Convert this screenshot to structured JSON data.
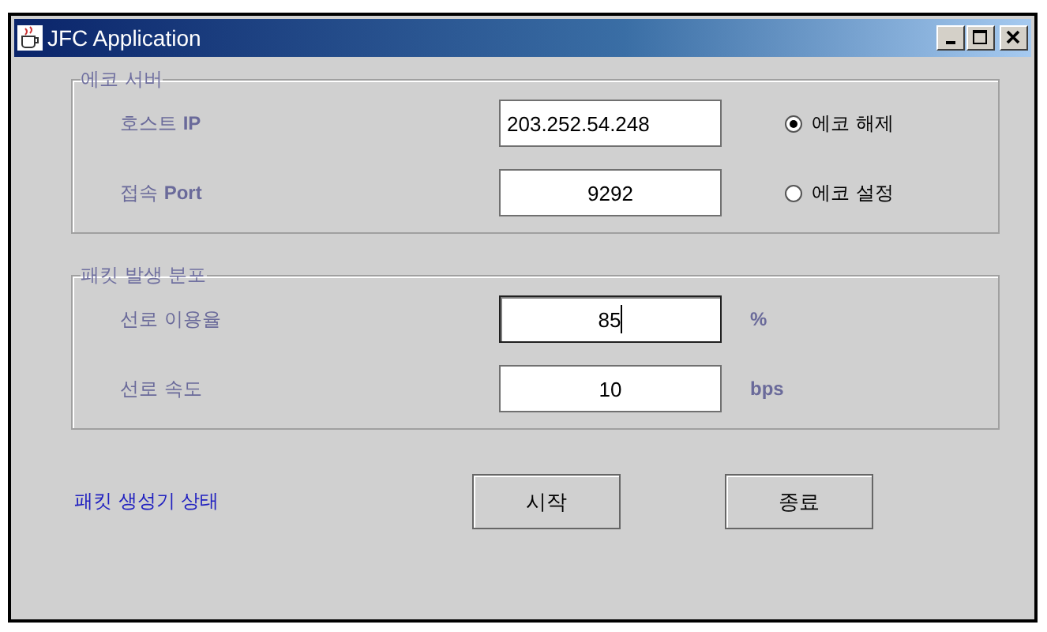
{
  "window": {
    "title": "JFC Application"
  },
  "server_group": {
    "title": "에코 서버",
    "fields": [
      {
        "label": "호스트 **IP**",
        "value": "203.252.54.248",
        "focused": false
      },
      {
        "label": "접속 **Port**",
        "value": "9292",
        "focused": false
      }
    ],
    "radios": [
      {
        "label": "에코 해제",
        "selected": true
      },
      {
        "label": "에코 설정",
        "selected": false
      }
    ]
  },
  "packet_group": {
    "title": "패킷 발생 분포",
    "fields": [
      {
        "label": "선로 이용율",
        "value": "85",
        "unit": "%",
        "focused": true
      },
      {
        "label": "선로 속도",
        "value": "10",
        "unit": "bps",
        "focused": false
      }
    ]
  },
  "status": "패킷 생성기 상태",
  "buttons": [
    "시작",
    "종료"
  ]
}
